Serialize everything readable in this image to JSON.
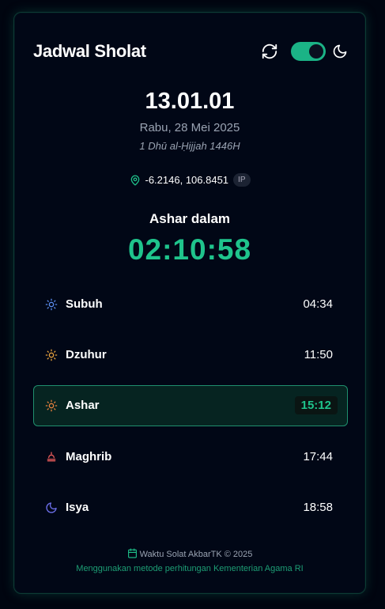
{
  "header": {
    "title": "Jadwal Sholat",
    "dark_mode": true
  },
  "clock": "13.01.01",
  "gregorian_date": "Rabu, 28 Mei 2025",
  "hijri_date": "1 Dhū al-Ḥijjah 1446H",
  "location": {
    "coords": "-6.2146, 106.8451",
    "source_badge": "IP"
  },
  "next_prayer": {
    "label": "Ashar dalam",
    "countdown": "02:10:58"
  },
  "prayers": [
    {
      "name": "Subuh",
      "time": "04:34",
      "icon": "sun-icon",
      "color": "#5b8def",
      "active": false
    },
    {
      "name": "Dzuhur",
      "time": "11:50",
      "icon": "sun-icon",
      "color": "#e8a33d",
      "active": false
    },
    {
      "name": "Ashar",
      "time": "15:12",
      "icon": "sun-icon",
      "color": "#e8823d",
      "active": true
    },
    {
      "name": "Maghrib",
      "time": "17:44",
      "icon": "sunset-icon",
      "color": "#e85a5a",
      "active": false
    },
    {
      "name": "Isya",
      "time": "18:58",
      "icon": "moon-icon",
      "color": "#6b6ee8",
      "active": false
    }
  ],
  "footer": {
    "credit": "Waktu Solat AkbarTK © 2025",
    "method": "Menggunakan metode perhitungan Kementerian Agama RI"
  },
  "colors": {
    "accent": "#1fc48c",
    "background": "#000510",
    "card_border": "#0d3b34"
  }
}
